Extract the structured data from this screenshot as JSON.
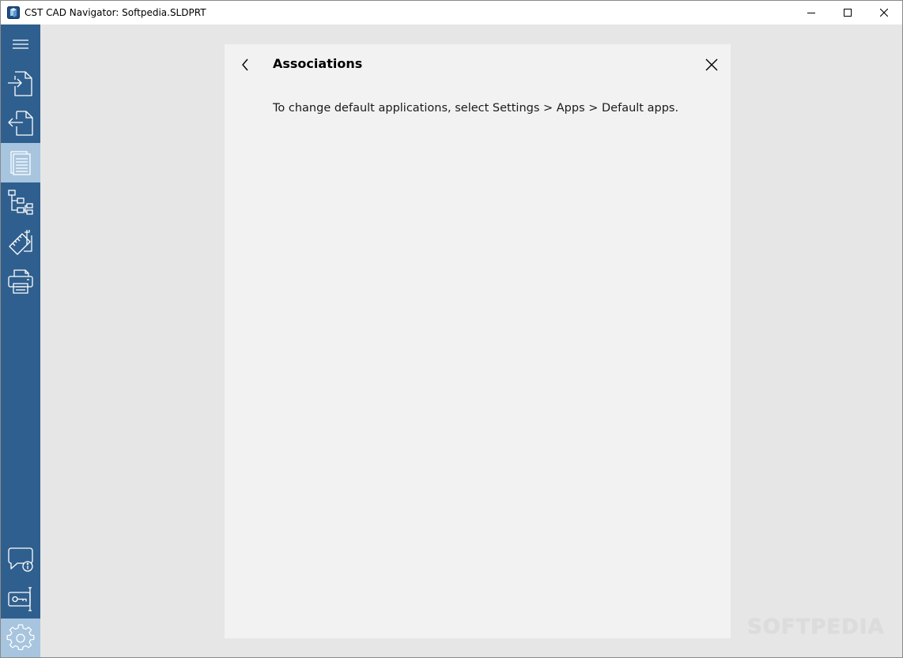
{
  "window": {
    "title": "CST CAD Navigator: Softpedia.SLDPRT",
    "app_icon": "cst-cad-app-icon"
  },
  "title_controls": [
    {
      "name": "minimize-button",
      "icon": "minimize-icon"
    },
    {
      "name": "maximize-button",
      "icon": "maximize-icon"
    },
    {
      "name": "close-window-button",
      "icon": "close-icon"
    }
  ],
  "sidebar": {
    "top_items": [
      {
        "name": "menu",
        "icon": "hamburger-icon",
        "active": false
      },
      {
        "name": "import",
        "icon": "import-file-icon",
        "active": false
      },
      {
        "name": "export",
        "icon": "export-file-icon",
        "active": false
      },
      {
        "name": "documents",
        "icon": "document-pages-icon",
        "active": true
      },
      {
        "name": "structure-tree",
        "icon": "tree-structure-icon",
        "active": false
      },
      {
        "name": "measure",
        "icon": "measure-ruler-icon",
        "active": false
      },
      {
        "name": "print",
        "icon": "printer-icon",
        "active": false
      }
    ],
    "bottom_items": [
      {
        "name": "feedback-info",
        "icon": "chat-info-icon",
        "active": false
      },
      {
        "name": "license",
        "icon": "license-key-icon",
        "active": false
      },
      {
        "name": "settings",
        "icon": "gear-icon",
        "active": true
      }
    ],
    "colors": {
      "background": "#2f5f8e",
      "active": "#a7c5df",
      "icon": "#ffffff"
    }
  },
  "panel": {
    "title": "Associations",
    "description": "To change default applications, select Settings > Apps > Default apps."
  },
  "watermark": "SOFTPEDIA"
}
